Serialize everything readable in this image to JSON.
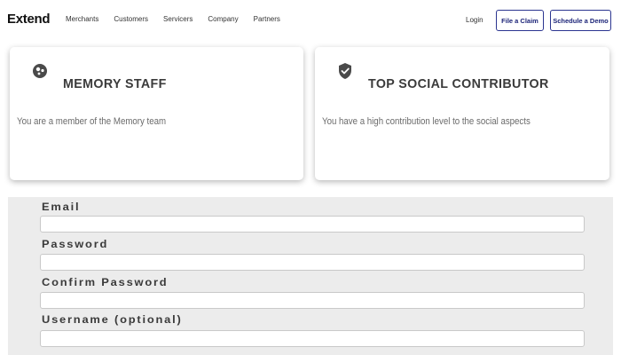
{
  "nav": {
    "logo": "Extend",
    "links": [
      "Merchants",
      "Customers",
      "Servicers",
      "Company",
      "Partners"
    ],
    "login": "Login",
    "file_claim": "File a Claim",
    "schedule_demo": "Schedule a Demo"
  },
  "badges": [
    {
      "icon": "memory-staff-icon",
      "title": "MEMORY STAFF",
      "description": "You are a member of the Memory team"
    },
    {
      "icon": "shield-check-icon",
      "title": "TOP SOCIAL CONTRIBUTOR",
      "description": "You have a high contribution level to the social aspects"
    }
  ],
  "form": {
    "fields": [
      {
        "label": "Email",
        "value": ""
      },
      {
        "label": "Password",
        "value": ""
      },
      {
        "label": "Confirm Password",
        "value": ""
      },
      {
        "label": "Username (optional)",
        "value": ""
      }
    ]
  }
}
